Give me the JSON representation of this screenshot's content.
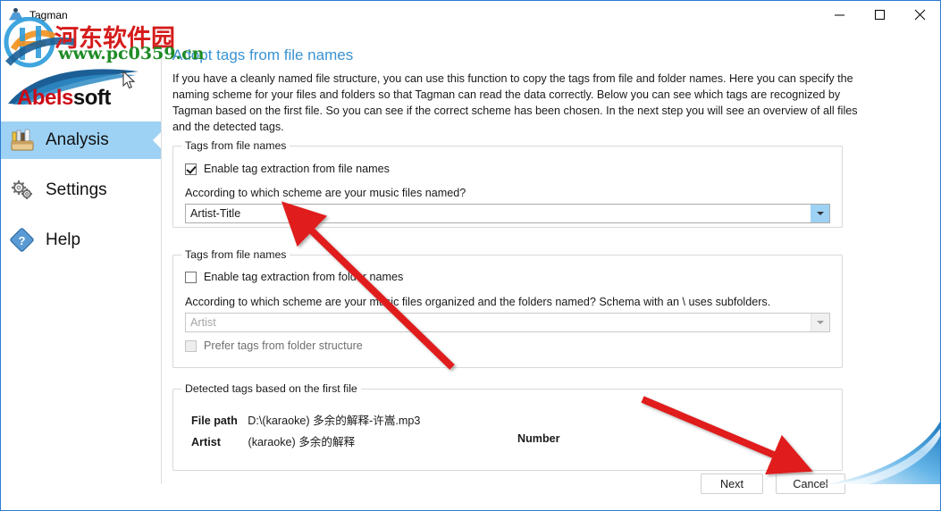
{
  "window": {
    "title": "Tagman",
    "icon": "tagman-app-icon",
    "controls": {
      "minimize": "minimize-icon",
      "maximize": "maximize-icon",
      "close": "close-icon"
    }
  },
  "sidebar": {
    "brand": {
      "name_part1": "Abels",
      "name_part2": "soft"
    },
    "items": [
      {
        "label": "Analysis",
        "icon": "toolbox-icon",
        "active": true
      },
      {
        "label": "Settings",
        "icon": "gears-icon",
        "active": false
      },
      {
        "label": "Help",
        "icon": "question-diamond-icon",
        "active": false
      }
    ]
  },
  "main": {
    "title": "Adopt tags from file names",
    "description": "If you have a cleanly named file structure, you can use this function to copy the tags from file and folder names. Here you can specify the naming scheme for your files and folders so that Tagman can read the data correctly. Below you can see which tags are recognized by Tagman based on the first file. So you can see if the correct scheme has been chosen. In the next step you will see an overview of all files and the detected tags.",
    "group_file": {
      "title": "Tags from file names",
      "checkbox_label": "Enable tag extraction from file names",
      "checkbox_checked": true,
      "field_label": "According to which scheme are your music files named?",
      "combo_value": "Artist-Title",
      "combo_placeholder": "Artist-Title",
      "combo_arrow_icon": "chevron-down-icon"
    },
    "group_folder": {
      "title": "Tags from file names",
      "checkbox_label": "Enable tag extraction from folder names",
      "checkbox_checked": false,
      "field_label": "According to which scheme are your music files organized and the folders named? Schema with an \\ uses subfolders.",
      "combo_value": "Artist",
      "combo_placeholder": "Artist",
      "combo_arrow_icon": "chevron-down-icon",
      "prefer_label": "Prefer tags from folder structure",
      "prefer_checked": false
    },
    "group_detected": {
      "title": "Detected tags based on the first file",
      "rows": [
        {
          "key": "File path",
          "value": "D:\\(karaoke) 多余的解释-许嵩.mp3",
          "extra": ""
        },
        {
          "key": "Artist",
          "value": "(karaoke) 多余的解释",
          "extra": "Number"
        }
      ]
    }
  },
  "footer": {
    "next_label": "Next",
    "cancel_label": "Cancel"
  },
  "watermark": {
    "site_name": "河东软件园",
    "site_url": "www.pc0359.cn",
    "logo": "watermark-logo-icon"
  },
  "colors": {
    "accent_blue": "#3a92d2",
    "sidebar_selected": "#9ed2f5",
    "brand_red": "#cc0b16",
    "annotation_red": "#e01b1b",
    "watermark_red": "#d51c1c",
    "watermark_green": "#1f8b26"
  }
}
